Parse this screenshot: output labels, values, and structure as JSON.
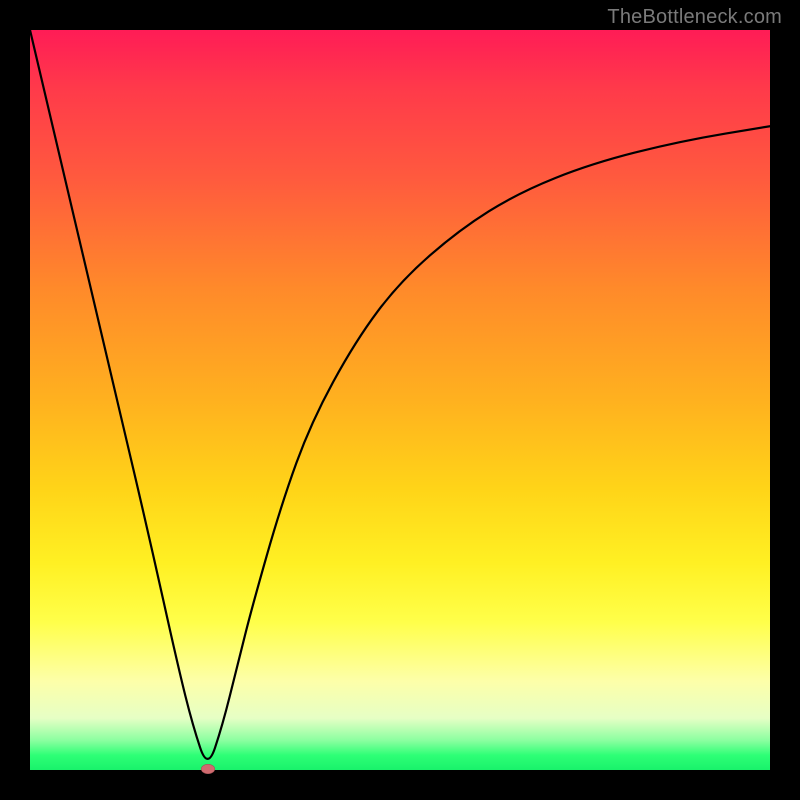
{
  "watermark": "TheBottleneck.com",
  "chart_data": {
    "type": "line",
    "title": "",
    "xlabel": "",
    "ylabel": "",
    "xlim": [
      0,
      100
    ],
    "ylim": [
      0,
      100
    ],
    "grid": false,
    "legend": false,
    "note": "Approximate V-shaped bottleneck curve. y is bottleneck % (0 at green bottom, 100 at red top). x is relative component score. Minimum (optimal match) near x≈24.",
    "series": [
      {
        "name": "bottleneck-curve",
        "x": [
          0,
          4,
          8,
          12,
          16,
          20,
          22,
          24,
          26,
          28,
          30,
          34,
          38,
          44,
          50,
          58,
          66,
          76,
          88,
          100
        ],
        "values": [
          100,
          83,
          66,
          49,
          32,
          14,
          6,
          0,
          6,
          14,
          22,
          36,
          47,
          58,
          66,
          73,
          78,
          82,
          85,
          87
        ]
      }
    ],
    "marker": {
      "x": 24,
      "y": 0
    },
    "gradient_stops": [
      {
        "pos": 0.0,
        "color": "#ff1c56"
      },
      {
        "pos": 0.35,
        "color": "#ff8a2a"
      },
      {
        "pos": 0.72,
        "color": "#fff023"
      },
      {
        "pos": 0.96,
        "color": "#8bffa0"
      },
      {
        "pos": 1.0,
        "color": "#19f26b"
      }
    ]
  }
}
